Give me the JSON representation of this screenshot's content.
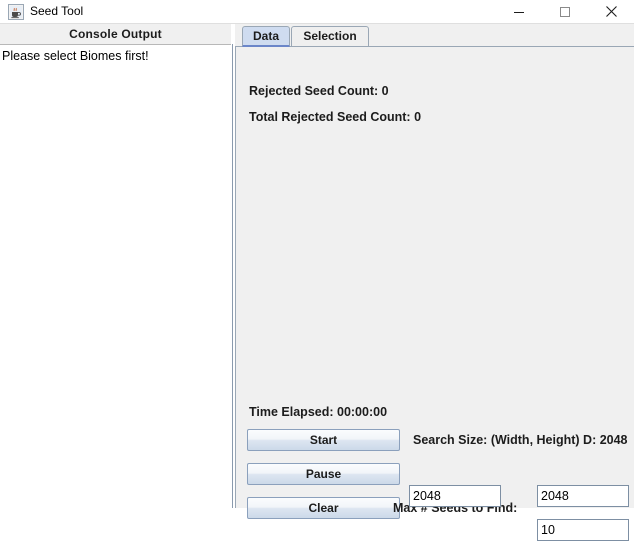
{
  "window": {
    "title": "Seed Tool",
    "icon": "java-coffee-cup-icon",
    "controls": {
      "minimize": "minimize-icon",
      "maximize": "maximize-icon",
      "close": "close-icon"
    }
  },
  "console": {
    "header": "Console Output",
    "lines": [
      "Please select Biomes first!"
    ]
  },
  "tabs": [
    {
      "label": "Data",
      "selected": true
    },
    {
      "label": "Selection",
      "selected": false
    }
  ],
  "data_tab": {
    "rejected_seed_count": "Rejected Seed Count: 0",
    "total_rejected_seed_count": "Total Rejected Seed Count: 0",
    "time_elapsed": "Time Elapsed: 00:00:00",
    "buttons": {
      "start": "Start",
      "pause": "Pause",
      "clear": "Clear"
    },
    "labels": {
      "search_size": "Search Size: (Width, Height) D: 2048",
      "max_seeds": "Max # Seeds to Find:"
    },
    "fields": {
      "width": "2048",
      "height": "2048",
      "max_seeds": "10"
    }
  },
  "colors": {
    "panel_bg": "#f0f0f0",
    "tab_selected_bg": "#cfdcf0",
    "tab_selected_underline": "#6b86c9",
    "border": "#9aa7b5",
    "text": "#1c1c1c",
    "field_bg": "#ffffff"
  }
}
